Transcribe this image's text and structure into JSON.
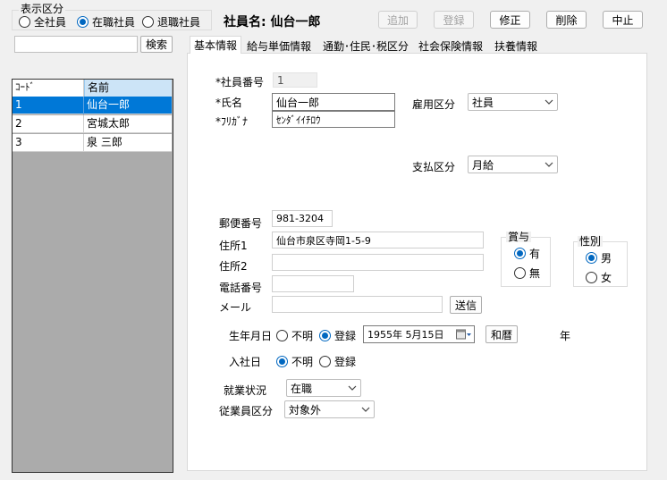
{
  "filter": {
    "group_title": "表示区分",
    "options": [
      "全社員",
      "在職社員",
      "退職社員"
    ],
    "selected_index": 1
  },
  "employee_header": "社員名: 仙台一郎",
  "toolbar": {
    "add_label": "追加",
    "register_label": "登録",
    "edit_label": "修正",
    "delete_label": "削除",
    "cancel_label": "中止"
  },
  "search": {
    "value": "",
    "button_label": "検索"
  },
  "grid": {
    "headers": [
      "ｺｰﾄﾞ",
      "名前"
    ],
    "rows": [
      {
        "code": "1",
        "name": "仙台一郎",
        "selected": true
      },
      {
        "code": "2",
        "name": "宮城太郎",
        "selected": false
      },
      {
        "code": "3",
        "name": "泉 三郎",
        "selected": false
      }
    ]
  },
  "tabs": [
    "基本情報",
    "給与単価情報",
    "通勤･住民･税区分",
    "社会保険情報",
    "扶養情報"
  ],
  "active_tab": 0,
  "form": {
    "employee_no_label": "*社員番号",
    "employee_no_value": "1",
    "name_label": "*氏名",
    "name_value": "仙台一郎",
    "furigana_label": "*ﾌﾘｶﾞﾅ",
    "furigana_value": "ｾﾝﾀﾞｲｲﾁﾛｳ",
    "employment_type_label": "雇用区分",
    "employment_type_value": "社員",
    "payment_type_label": "支払区分",
    "payment_type_value": "月給",
    "postal_label": "郵便番号",
    "postal_value": "981-3204",
    "address1_label": "住所1",
    "address1_value": "仙台市泉区寺岡1-5-9",
    "address2_label": "住所2",
    "address2_value": "",
    "phone_label": "電話番号",
    "phone_value": "",
    "email_label": "メール",
    "email_value": "",
    "send_button_label": "送信",
    "bonus_title": "賞与",
    "bonus_options": [
      "有",
      "無"
    ],
    "bonus_selected": 0,
    "gender_title": "性別",
    "gender_options": [
      "男",
      "女"
    ],
    "gender_selected": 0,
    "birthdate_label": "生年月日",
    "birthdate_options": [
      "不明",
      "登録"
    ],
    "birthdate_selected": 1,
    "birthdate_value": "1955年  5月15日",
    "wareki_button_label": "和暦",
    "age_unit": "年",
    "hire_date_label": "入社日",
    "hire_date_options": [
      "不明",
      "登録"
    ],
    "hire_date_selected": 0,
    "work_status_label": "就業状況",
    "work_status_value": "在職",
    "employee_class_label": "従業員区分",
    "employee_class_value": "対象外"
  },
  "colors": {
    "selection": "#0078d7",
    "radio_accent": "#0067c0",
    "grid_empty": "#ababab"
  }
}
